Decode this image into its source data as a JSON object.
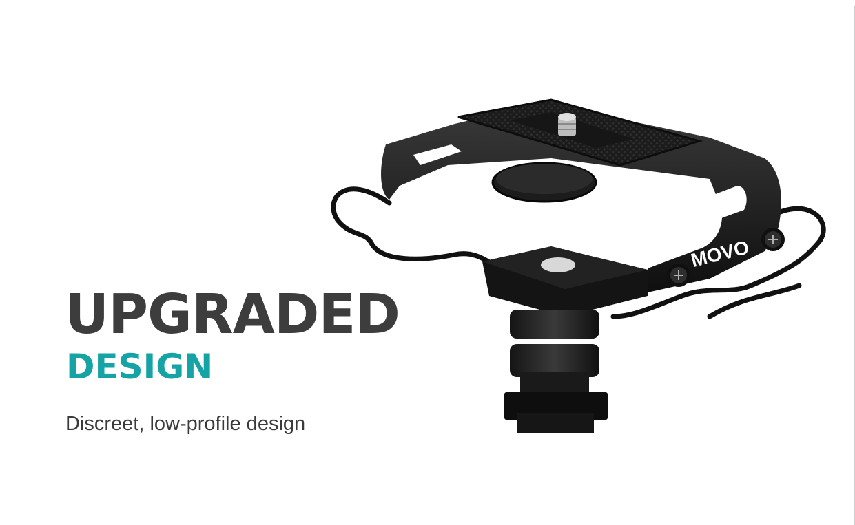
{
  "headline": "UPGRADED",
  "subheadline": "DESIGN",
  "caption": "Discreet, low-profile design",
  "product": {
    "brand_text": "MOVO",
    "description": "black shock mount with cold shoe base"
  },
  "colors": {
    "headline": "#3d3d3d",
    "accent": "#15a3a5",
    "caption": "#3a3a3a",
    "background": "#ffffff",
    "product": "#1a1a1a"
  }
}
